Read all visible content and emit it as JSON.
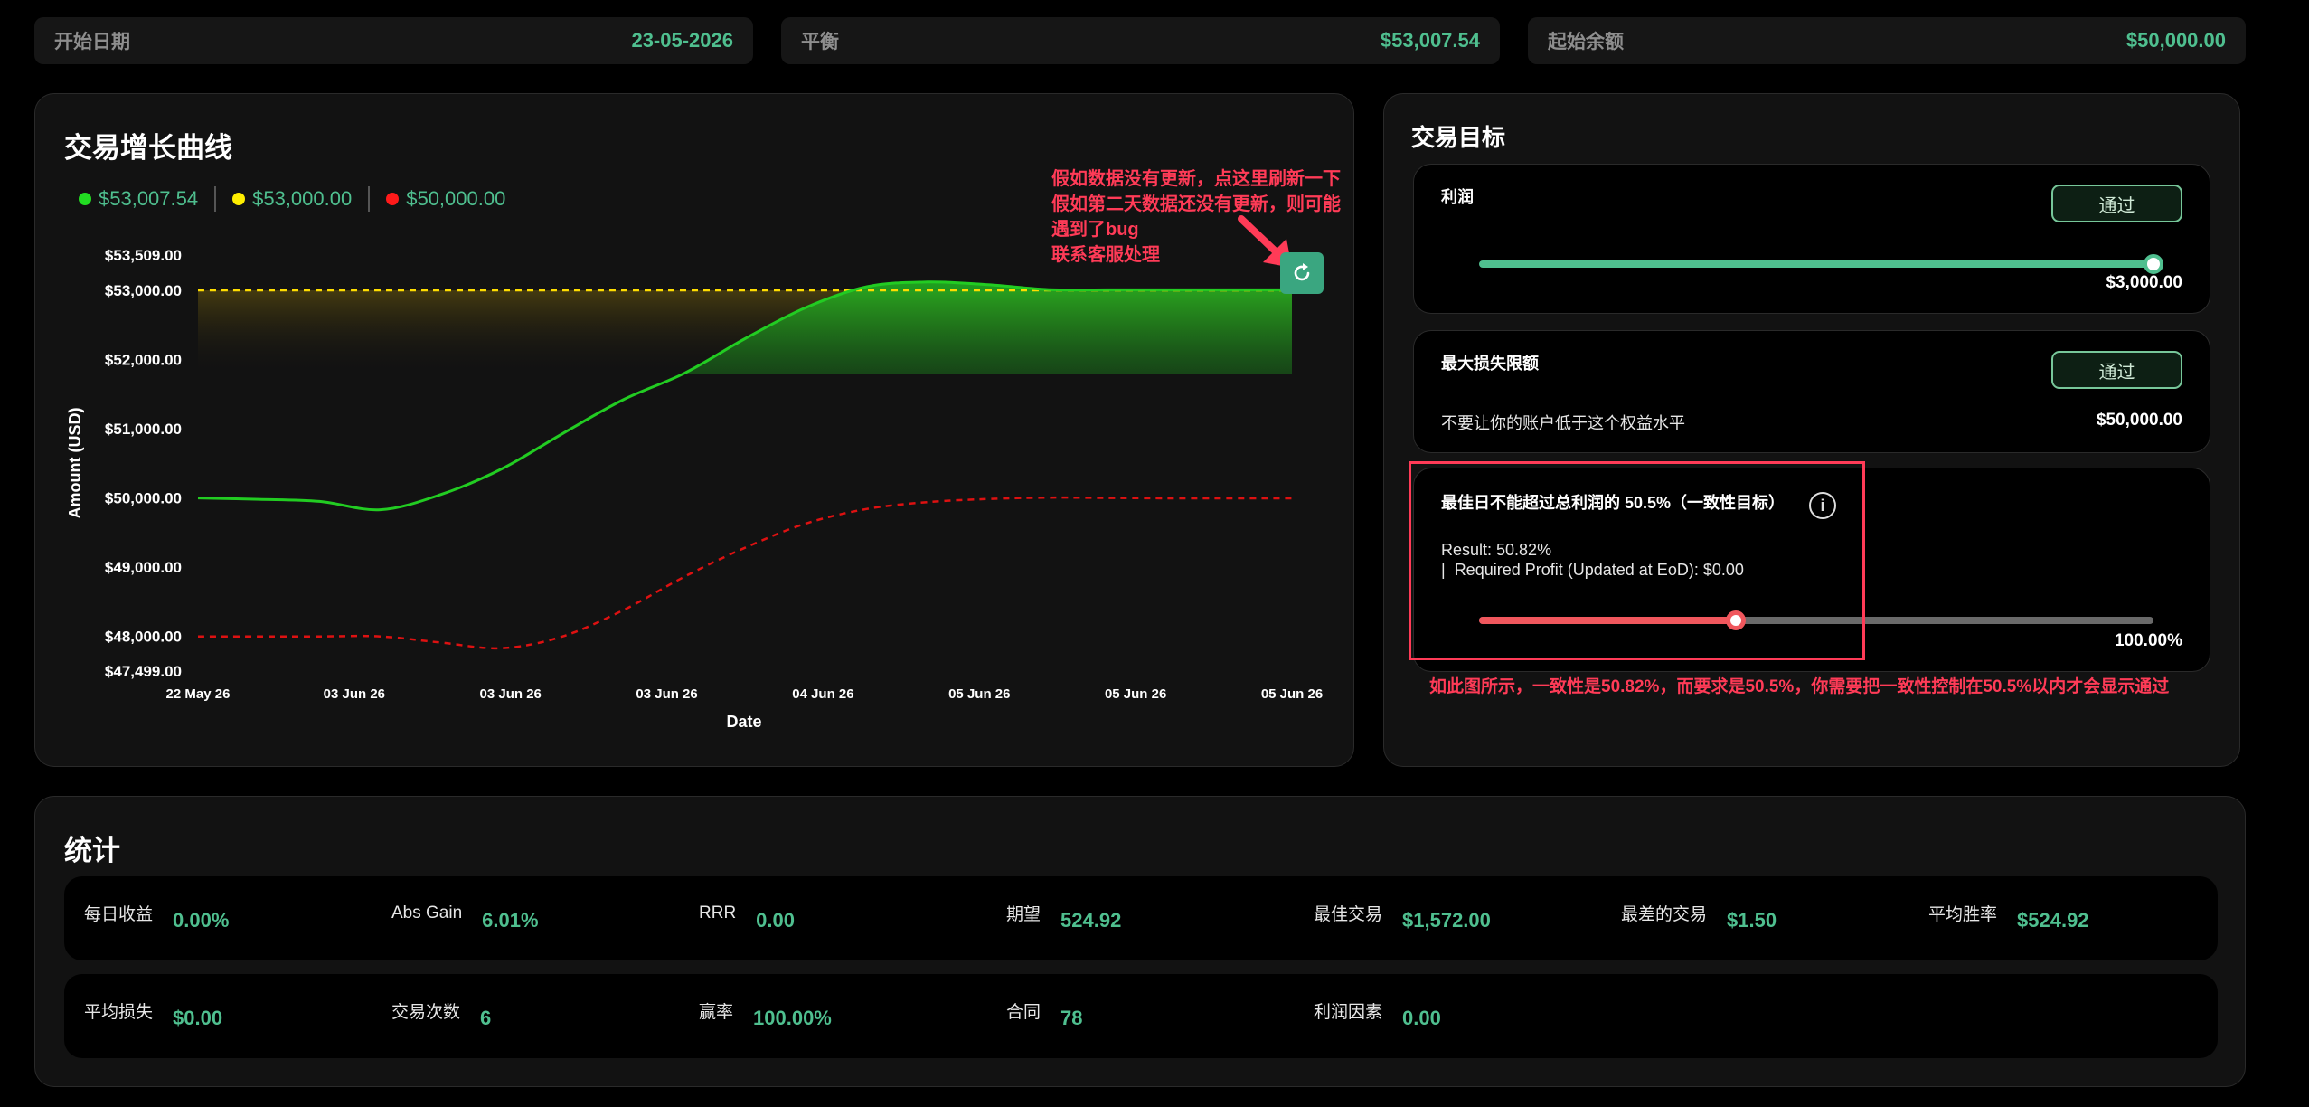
{
  "summary": {
    "start_date_label": "开始日期",
    "start_date_value": "23-05-2026",
    "balance_label": "平衡",
    "balance_value": "$53,007.54",
    "initial_balance_label": "起始余额",
    "initial_balance_value": "$50,000.00"
  },
  "growth": {
    "title": "交易增长曲线",
    "legend": [
      {
        "label": "$53,007.54",
        "color": "#22dd22"
      },
      {
        "label": "$53,000.00",
        "color": "#ffee00"
      },
      {
        "label": "$50,000.00",
        "color": "#ff1a1a"
      }
    ],
    "annotation": [
      "假如数据没有更新，点这里刷新一下",
      "假如第二天数据还没有更新，则可能遇到了bug",
      "联系客服处理"
    ],
    "refresh_icon": "refresh-icon",
    "chart_data": {
      "type": "line",
      "xlabel": "Date",
      "ylabel": "Amount (USD)",
      "x_ticks": [
        "22 May 26",
        "03 Jun 26",
        "03 Jun 26",
        "03 Jun 26",
        "04 Jun 26",
        "05 Jun 26",
        "05 Jun 26",
        "05 Jun 26"
      ],
      "y_ticks": [
        "$53,509.00",
        "$53,000.00",
        "$52,000.00",
        "$51,000.00",
        "$50,000.00",
        "$49,000.00",
        "$48,000.00",
        "$47,499.00"
      ],
      "y_tick_values": [
        53509,
        53000,
        52000,
        51000,
        50000,
        49000,
        48000,
        47499
      ],
      "ylim": [
        47499,
        53509
      ],
      "series": [
        {
          "color": "#22cc22",
          "style": "solid",
          "values": [
            50000,
            49980,
            49950,
            49830,
            50050,
            50420,
            50930,
            51420,
            51800,
            52300,
            52750,
            53050,
            53120,
            53080,
            53010,
            53007.54,
            53007.54,
            53007.54,
            53007.54
          ]
        },
        {
          "color": "#ffdd00",
          "style": "dashed",
          "values": [
            53000,
            53000,
            53000,
            53000,
            53000,
            53000,
            53000,
            53000,
            53000,
            53000,
            53000,
            53000,
            53000,
            53000,
            53000,
            53000,
            53000,
            53000,
            53000
          ]
        },
        {
          "color": "#dd1111",
          "style": "dashed",
          "values": [
            48000,
            48000,
            48000,
            48000,
            47910,
            47830,
            48000,
            48380,
            48860,
            49280,
            49630,
            49840,
            49940,
            49985,
            50005,
            50000,
            49995,
            49995,
            49995
          ]
        }
      ],
      "grid": false
    }
  },
  "goals": {
    "title": "交易目标",
    "profit": {
      "name": "利润",
      "status": "通过",
      "amount": "$3,000.00",
      "progress": 1.0,
      "color": "#4fbf8f"
    },
    "max_loss": {
      "name": "最大损失限额",
      "status": "通过",
      "desc": "不要让你的账户低于这个权益水平",
      "amount": "$50,000.00"
    },
    "consistency": {
      "name": "最佳日不能超过总利润的 50.5%（一致性目标）",
      "result": "Result: 50.82%",
      "required": "Required Profit (Updated at EoD): $0.00",
      "max_label": "100.00%",
      "progress": 0.5082,
      "color": "#f0575d",
      "info_icon": "info-icon"
    },
    "annotation": "如此图所示，一致性是50.82%，而要求是50.5%，你需要把一致性控制在50.5%以内才会显示通过"
  },
  "stats": {
    "title": "统计",
    "row1": [
      {
        "k": "每日收益",
        "v": "0.00%"
      },
      {
        "k": "Abs Gain",
        "v": "6.01%"
      },
      {
        "k": "RRR",
        "v": "0.00"
      },
      {
        "k": "期望",
        "v": "524.92"
      },
      {
        "k": "最佳交易",
        "v": "$1,572.00"
      },
      {
        "k": "最差的交易",
        "v": "$1.50"
      },
      {
        "k": "平均胜率",
        "v": "$524.92"
      }
    ],
    "row2": [
      {
        "k": "平均损失",
        "v": "$0.00"
      },
      {
        "k": "交易次数",
        "v": "6"
      },
      {
        "k": "赢率",
        "v": "100.00%"
      },
      {
        "k": "合同",
        "v": "78"
      },
      {
        "k": "利润因素",
        "v": "0.00"
      }
    ]
  }
}
